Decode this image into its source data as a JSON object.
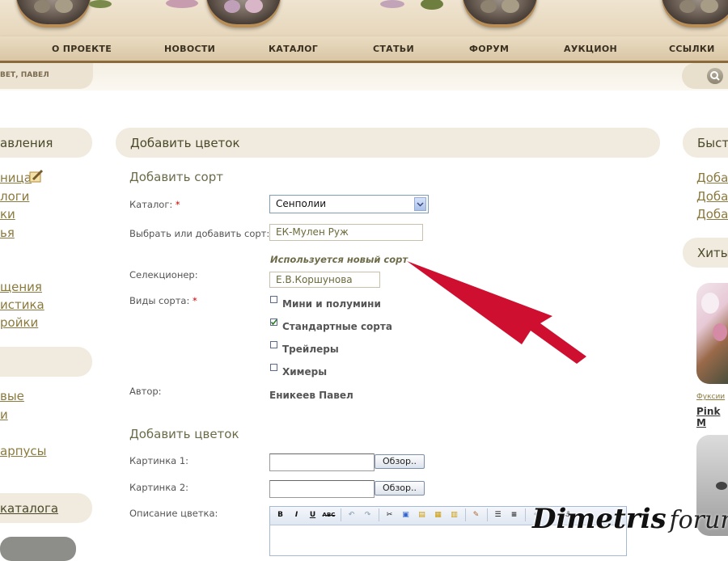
{
  "nav": {
    "items": [
      "О ПРОЕКТЕ",
      "НОВОСТИ",
      "КАТАЛОГ",
      "СТАТЬИ",
      "ФОРУМ",
      "АУКЦИОН",
      "ССЫЛКИ"
    ]
  },
  "user_bar": {
    "text": "ВЕТ, ПАВЕЛ"
  },
  "left_sidebar": {
    "section1_title": "авления",
    "section1_links": [
      "ница",
      "логи",
      "ки",
      "ья"
    ],
    "section2_links": [
      "щения",
      "истика",
      "ройки"
    ],
    "section3_links": [
      "вые",
      "и",
      "арпусы"
    ],
    "section4_title": "каталога"
  },
  "main": {
    "title": "Добавить цветок",
    "subtitle_variety": "Добавить сорт",
    "catalog_label": "Каталог:",
    "catalog_value": "Сенполии",
    "variety_label": "Выбрать или добавить сорт:",
    "variety_value": "ЕК-Мулен Руж",
    "new_variety_note": "Используется новый сорт",
    "breeder_label": "Селекционер:",
    "breeder_value": "Е.В.Коршунова",
    "types_label": "Виды сорта:",
    "types": [
      {
        "label": "Мини и полумини",
        "checked": false
      },
      {
        "label": "Стандартные сорта",
        "checked": true
      },
      {
        "label": "Трейлеры",
        "checked": false
      },
      {
        "label": "Химеры",
        "checked": false
      }
    ],
    "author_label": "Автор:",
    "author_value": "Еникеев Павел",
    "subtitle_flower": "Добавить цветок",
    "picture1_label": "Картинка 1:",
    "picture2_label": "Картинка 2:",
    "browse_label": "Обзор..",
    "description_label": "Описание цветка:",
    "required_mark": "*",
    "editor_bold": "B",
    "editor_italic": "I",
    "editor_underline": "U",
    "editor_strike": "ABC"
  },
  "right_sidebar": {
    "title1": "Быстр",
    "links": [
      "Доба",
      "Доба",
      "Доба"
    ],
    "title2": "Хиты",
    "item_category": "Фуксии",
    "item_title": "Pink M"
  },
  "watermark": {
    "text1": "Dimetris",
    "text2": "forum"
  },
  "colors": {
    "arrow": "#cf0f30",
    "accent_text": "#8b7a3e",
    "nav_border": "#8a6a3a"
  }
}
